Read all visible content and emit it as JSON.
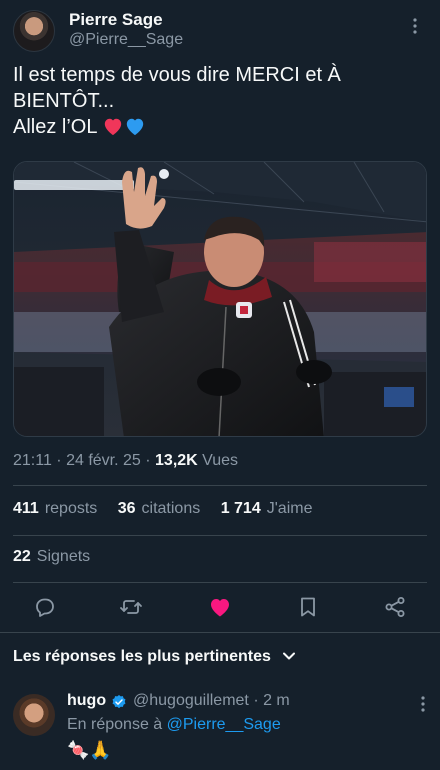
{
  "author": {
    "name": "Pierre Sage",
    "handle": "@Pierre__Sage"
  },
  "tweet": {
    "line1": "Il est temps de vous dire MERCI et À",
    "line2": "BIENTÔT...",
    "line3": "Allez l’OL ",
    "emoji": "❤️💙"
  },
  "meta": {
    "time": "21:11 · 24 févr. 25 · ",
    "views_count": "13,2K",
    "views_label": " Vues"
  },
  "stats": {
    "reposts_count": "411",
    "reposts_label": "reposts",
    "quotes_count": "36",
    "quotes_label": "citations",
    "likes_count": "1 714",
    "likes_label": "J'aime"
  },
  "bookmarks": {
    "count": "22",
    "label": "Signets"
  },
  "actions": {
    "icons": [
      "reply-icon",
      "repost-icon",
      "like-icon",
      "bookmark-icon",
      "share-icon"
    ],
    "like_color": "#f91880"
  },
  "replies": {
    "sort_label": "Les réponses les plus pertinentes"
  },
  "reply": {
    "name": "hugo",
    "handle_time": "@hugoguillemet · 2 m",
    "reply_prefix": "En réponse à ",
    "mention": "@Pierre__Sage",
    "text": "🍬🙏"
  },
  "colors": {
    "background": "#15202b",
    "accent": "#1d9bf0",
    "muted": "#8b98a5"
  }
}
